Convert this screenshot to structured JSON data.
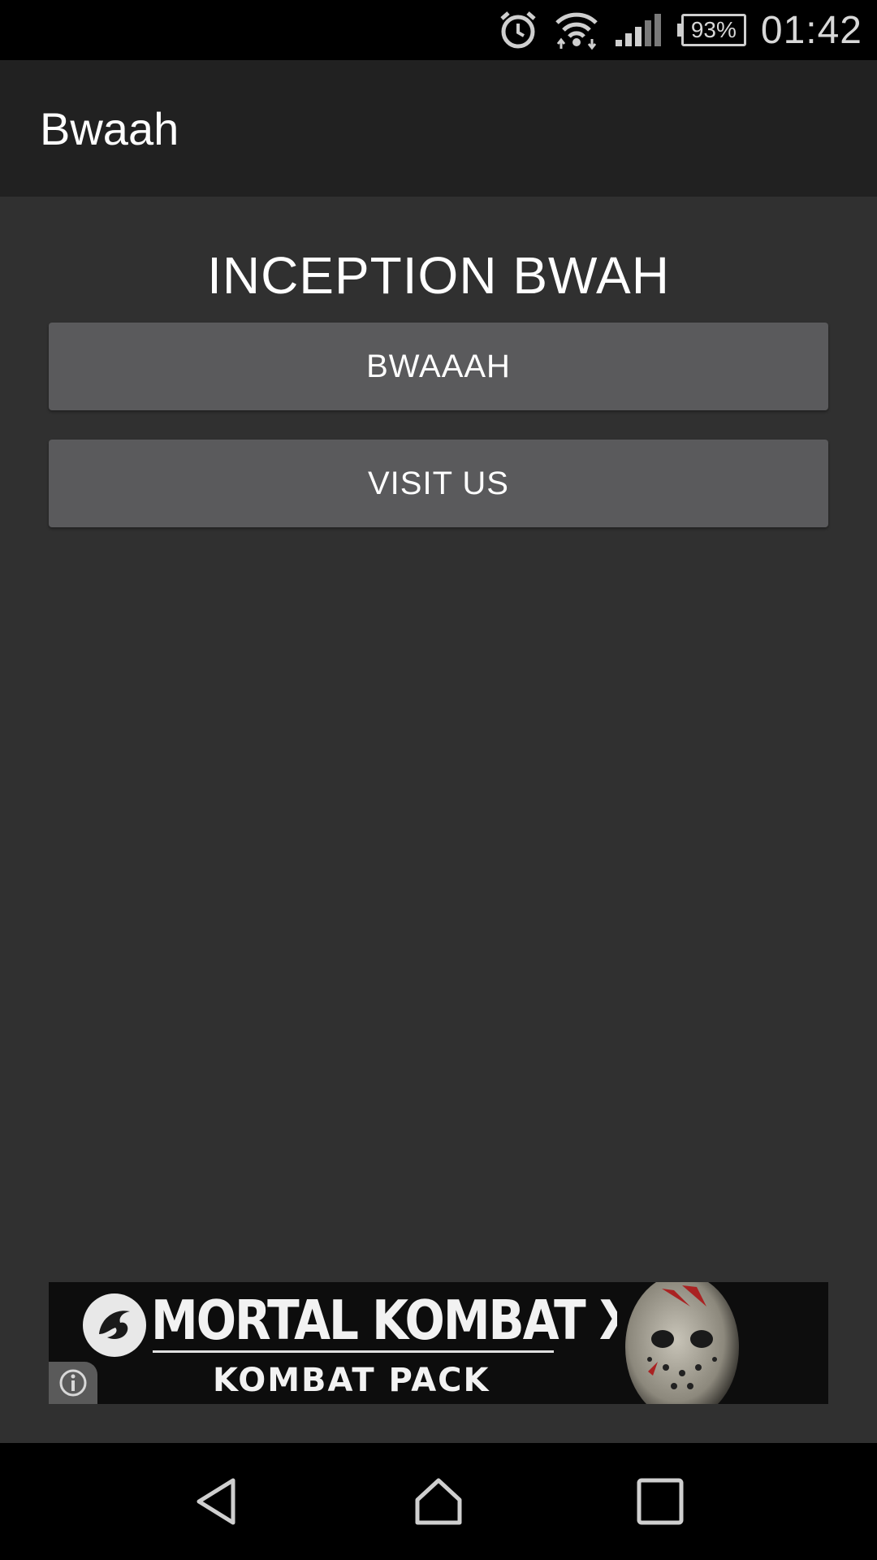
{
  "status_bar": {
    "time": "01:42",
    "battery_level": "93%",
    "icons": [
      "alarm-icon",
      "wifi-icon",
      "cell-signal-icon",
      "battery-icon"
    ]
  },
  "app_bar": {
    "title": "Bwaah"
  },
  "main": {
    "headline": "INCEPTION BWAH",
    "buttons": [
      {
        "label": "BWAAAH"
      },
      {
        "label": "VISIT US"
      }
    ]
  },
  "ad_banner": {
    "title": "MORTAL KOMBAT X",
    "subtitle": "KOMBAT PACK",
    "info_icon": "info-icon"
  },
  "nav_bar": {
    "icons": [
      "back-icon",
      "home-icon",
      "recents-icon"
    ]
  },
  "colors": {
    "background": "#303030",
    "app_bar": "#212121",
    "button": "#5a5a5c",
    "text": "#ffffff"
  }
}
